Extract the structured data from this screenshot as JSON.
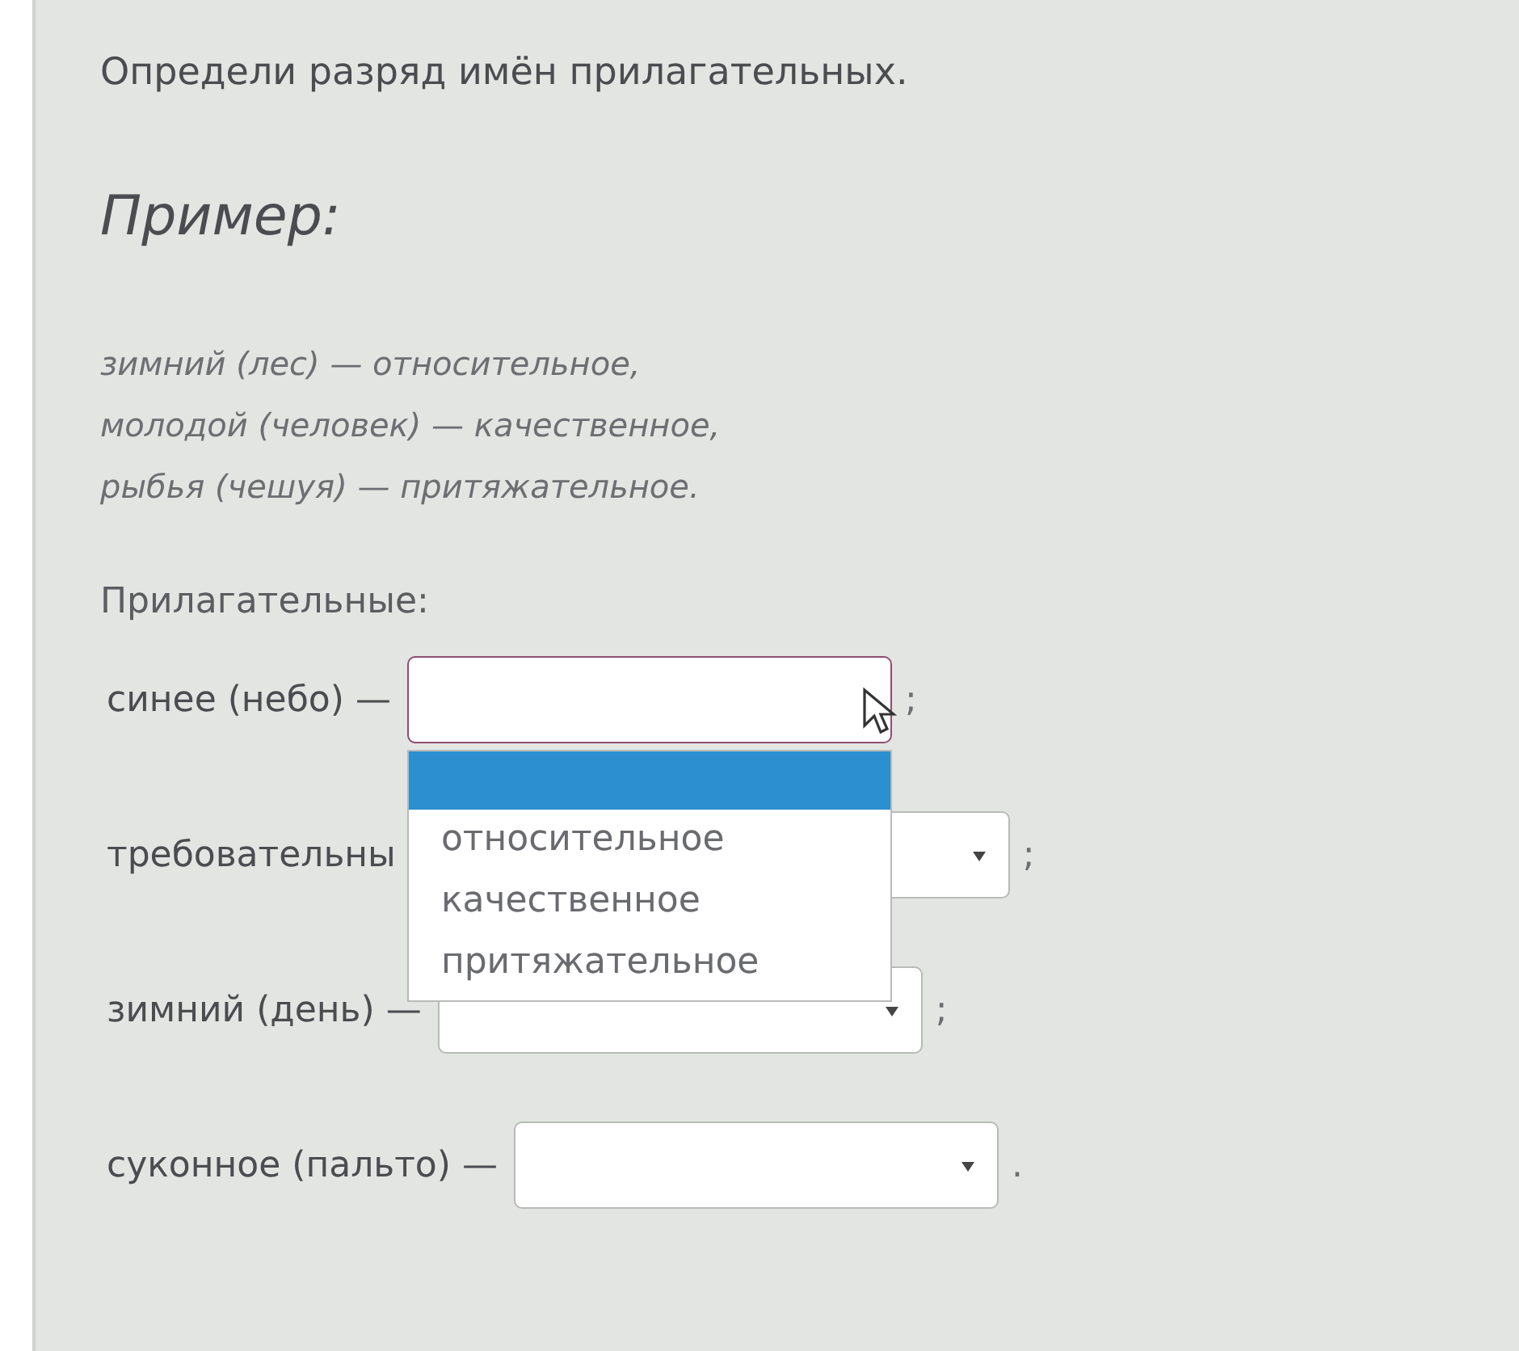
{
  "instruction": "Определи разряд имён прилагательных.",
  "example_heading": "Пример:",
  "example_lines": [
    "зимний (лес) — относительное,",
    "молодой (человек) — качественное,",
    "рыбья (чешуя) — притяжательное."
  ],
  "task_label": "Прилагательные:",
  "rows": [
    {
      "label": "синее (небо) —",
      "punct": ";",
      "open": true
    },
    {
      "label": "требовательны",
      "punct": ";",
      "open": false
    },
    {
      "label": "зимний (день) —",
      "punct": ";",
      "open": false
    },
    {
      "label": "суконное (пальто) —",
      "punct": ".",
      "open": false
    }
  ],
  "dropdown": {
    "blank_option_highlighted": true,
    "options": [
      {
        "label": "относительное",
        "selected": false
      },
      {
        "label": "качественное",
        "selected": false
      },
      {
        "label": "притяжательное",
        "selected": false
      }
    ]
  }
}
